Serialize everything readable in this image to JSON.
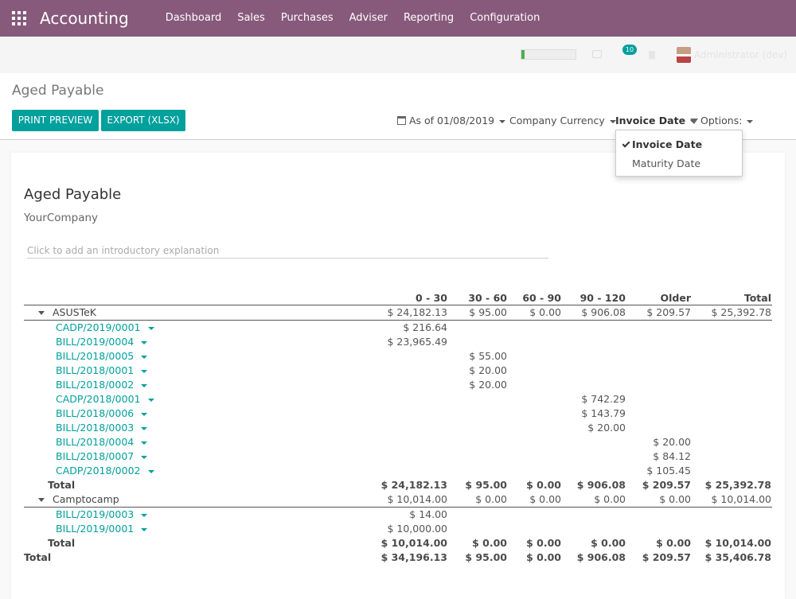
{
  "navbar": {
    "brand": "Accounting",
    "menu": [
      "Dashboard",
      "Sales",
      "Purchases",
      "Adviser",
      "Reporting",
      "Configuration"
    ]
  },
  "systray": {
    "notification_count": "10",
    "user_name": "Administrator (dev)",
    "progress": 0.06
  },
  "control_panel": {
    "title": "Aged Payable",
    "print_preview": "PRINT PREVIEW",
    "export": "EXPORT (XLSX)",
    "date_filter": "As of 01/08/2019",
    "currency_filter": "Company Currency",
    "date_type_filter": "Invoice Date",
    "options_filter": "Options:"
  },
  "dropdown": {
    "items": [
      "Invoice Date",
      "Maturity Date"
    ],
    "selected": "Invoice Date"
  },
  "report": {
    "title": "Aged Payable",
    "company": "YourCompany",
    "intro_placeholder": "Click to add an introductory explanation",
    "columns": [
      "0 - 30",
      "30 - 60",
      "60 - 90",
      "90 - 120",
      "Older",
      "Total"
    ],
    "partners": [
      {
        "name": "ASUSTeK",
        "summary": [
          "$ 24,182.13",
          "$ 95.00",
          "$ 0.00",
          "$ 906.08",
          "$ 209.57",
          "$ 25,392.78"
        ],
        "lines": [
          {
            "ref": "CADP/2019/0001",
            "col": 0,
            "amount": "$ 216.64"
          },
          {
            "ref": "BILL/2019/0004",
            "col": 0,
            "amount": "$ 23,965.49"
          },
          {
            "ref": "BILL/2018/0005",
            "col": 1,
            "amount": "$ 55.00"
          },
          {
            "ref": "BILL/2018/0001",
            "col": 1,
            "amount": "$ 20.00"
          },
          {
            "ref": "BILL/2018/0002",
            "col": 1,
            "amount": "$ 20.00"
          },
          {
            "ref": "CADP/2018/0001",
            "col": 3,
            "amount": "$ 742.29"
          },
          {
            "ref": "BILL/2018/0006",
            "col": 3,
            "amount": "$ 143.79"
          },
          {
            "ref": "BILL/2018/0003",
            "col": 3,
            "amount": "$ 20.00"
          },
          {
            "ref": "BILL/2018/0004",
            "col": 4,
            "amount": "$ 20.00"
          },
          {
            "ref": "BILL/2018/0007",
            "col": 4,
            "amount": "$ 84.12"
          },
          {
            "ref": "CADP/2018/0002",
            "col": 4,
            "amount": "$ 105.45"
          }
        ],
        "total_label": "Total",
        "total": [
          "$ 24,182.13",
          "$ 95.00",
          "$ 0.00",
          "$ 906.08",
          "$ 209.57",
          "$ 25,392.78"
        ]
      },
      {
        "name": "Camptocamp",
        "summary": [
          "$ 10,014.00",
          "$ 0.00",
          "$ 0.00",
          "$ 0.00",
          "$ 0.00",
          "$ 10,014.00"
        ],
        "lines": [
          {
            "ref": "BILL/2019/0003",
            "col": 0,
            "amount": "$ 14.00"
          },
          {
            "ref": "BILL/2019/0001",
            "col": 0,
            "amount": "$ 10,000.00"
          }
        ],
        "total_label": "Total",
        "total": [
          "$ 10,014.00",
          "$ 0.00",
          "$ 0.00",
          "$ 0.00",
          "$ 0.00",
          "$ 10,014.00"
        ]
      }
    ],
    "grand_total_label": "Total",
    "grand_total": [
      "$ 34,196.13",
      "$ 95.00",
      "$ 0.00",
      "$ 906.08",
      "$ 209.57",
      "$ 35,406.78"
    ]
  }
}
